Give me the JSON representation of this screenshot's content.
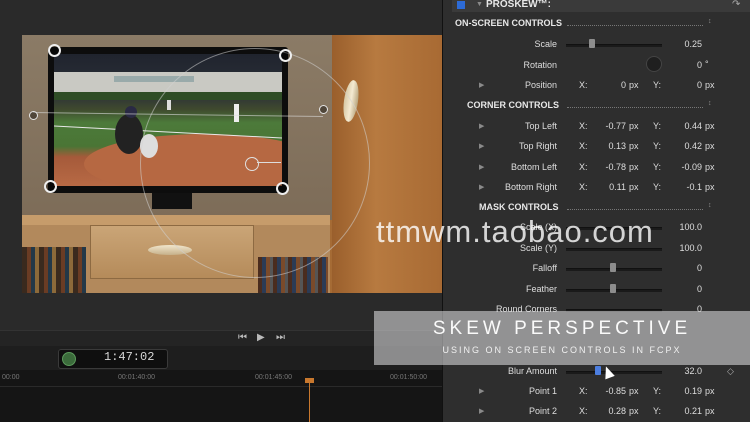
{
  "inspector": {
    "plugin_name": "PROSKEW™:",
    "sections": {
      "on_screen": "ON-SCREEN CONTROLS",
      "corner": "CORNER CONTROLS",
      "mask": "MASK CONTROLS"
    },
    "scale": {
      "label": "Scale",
      "value": "0.25"
    },
    "rotation": {
      "label": "Rotation",
      "value": "0",
      "unit": "°"
    },
    "position": {
      "label": "Position",
      "x": "0",
      "y": "0"
    },
    "top_left": {
      "label": "Top Left",
      "x": "-0.77",
      "y": "0.44"
    },
    "top_right": {
      "label": "Top Right",
      "x": "0.13",
      "y": "0.42"
    },
    "bottom_left": {
      "label": "Bottom Left",
      "x": "-0.78",
      "y": "-0.09"
    },
    "bottom_right": {
      "label": "Bottom Right",
      "x": "0.11",
      "y": "-0.1"
    },
    "scale_x": {
      "label": "Scale (X)",
      "value": "100.0"
    },
    "scale_y": {
      "label": "Scale (Y)",
      "value": "100.0"
    },
    "falloff": {
      "label": "Falloff",
      "value": "0"
    },
    "feather": {
      "label": "Feather",
      "value": "0"
    },
    "round_corners": {
      "label": "Round Corners",
      "value": "0"
    },
    "blur_amount": {
      "label": "Blur Amount",
      "value": "32.0"
    },
    "point1": {
      "label": "Point 1",
      "x": "-0.85",
      "y": "0.19"
    },
    "point2": {
      "label": "Point 2",
      "x": "0.28",
      "y": "0.21"
    },
    "axis_x": "X:",
    "axis_y": "Y:",
    "unit_px": "px"
  },
  "viewer": {
    "timecode": "1:47:02",
    "ruler_ticks": [
      "00:00",
      "00:01:40:00",
      "00:01:45:00",
      "00:01:50:00"
    ]
  },
  "banner": {
    "title": "SKEW PERSPECTIVE",
    "subtitle": "USING ON SCREEN CONTROLS IN FCPX"
  },
  "watermark": "ttmwm.taobao.com",
  "colors": {
    "accent": "#2d6bd6",
    "playhead": "#c8782e"
  }
}
